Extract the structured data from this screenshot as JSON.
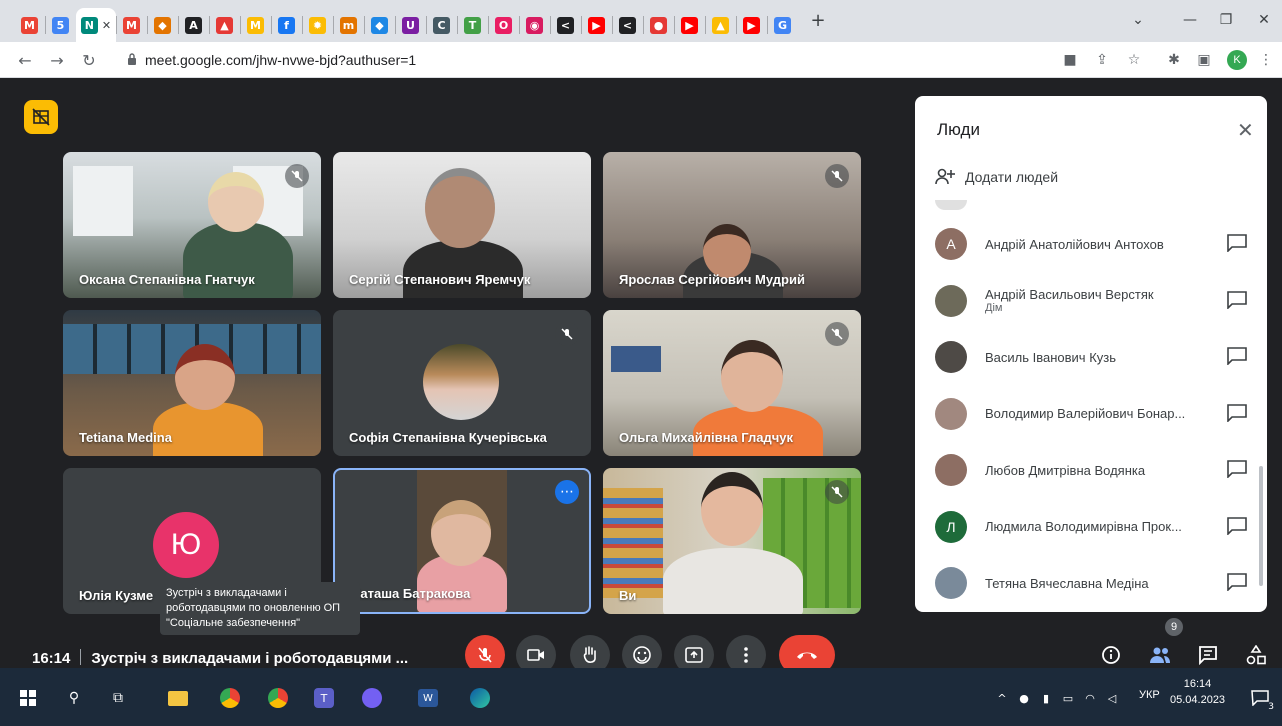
{
  "browser": {
    "url": "meet.google.com/jhw-nvwe-bjd?authuser=1",
    "active_tab_label": "N",
    "new_tab": "+",
    "profile_initial": "K",
    "tab_favicons": [
      {
        "name": "gmail-favicon",
        "glyph": "M",
        "color": "#ea4335"
      },
      {
        "name": "calendar-favicon",
        "glyph": "5",
        "color": "#4285f4"
      },
      {
        "name": "meet-favicon",
        "glyph": "N",
        "color": "#00897b"
      },
      {
        "name": "gmail2-favicon",
        "glyph": "M",
        "color": "#ea4335"
      },
      {
        "name": "app-favicon",
        "glyph": "◆",
        "color": "#e37400"
      },
      {
        "name": "font-favicon",
        "glyph": "A",
        "color": "#202124"
      },
      {
        "name": "pdf-favicon",
        "glyph": "▲",
        "color": "#e53935"
      },
      {
        "name": "m-favicon",
        "glyph": "M",
        "color": "#fbbc04"
      },
      {
        "name": "facebook-favicon",
        "glyph": "f",
        "color": "#1877f2"
      },
      {
        "name": "sun-favicon",
        "glyph": "✹",
        "color": "#fbbc04"
      },
      {
        "name": "m2-favicon",
        "glyph": "m",
        "color": "#e37400"
      },
      {
        "name": "diamond-favicon",
        "glyph": "◆",
        "color": "#1e88e5"
      },
      {
        "name": "u-favicon",
        "glyph": "U",
        "color": "#7b1fa2"
      },
      {
        "name": "c-favicon",
        "glyph": "C",
        "color": "#455a64"
      },
      {
        "name": "testy-favicon",
        "glyph": "T",
        "color": "#43a047"
      },
      {
        "name": "search-favicon",
        "glyph": "O",
        "color": "#e91e63"
      },
      {
        "name": "cake-favicon",
        "glyph": "◉",
        "color": "#d81b60"
      },
      {
        "name": "k-favicon",
        "glyph": "<",
        "color": "#202124"
      },
      {
        "name": "youtube-favicon",
        "glyph": "▶",
        "color": "#ff0000"
      },
      {
        "name": "k2-favicon",
        "glyph": "<",
        "color": "#202124"
      },
      {
        "name": "record-favicon",
        "glyph": "●",
        "color": "#e53935"
      },
      {
        "name": "youtube2-favicon",
        "glyph": "▶",
        "color": "#ff0000"
      },
      {
        "name": "drive-favicon",
        "glyph": "▲",
        "color": "#fbbc04"
      },
      {
        "name": "youtube3-favicon",
        "glyph": "▶",
        "color": "#ff0000"
      },
      {
        "name": "google-favicon",
        "glyph": "G",
        "color": "#4285f4"
      }
    ]
  },
  "tiles": [
    {
      "name": "Оксана Степанівна Гнатчук",
      "muted": true
    },
    {
      "name": "Сергій Степанович Яремчук",
      "muted": false
    },
    {
      "name": "Ярослав Сергійович Мудрий",
      "muted": true
    },
    {
      "name": "Tetiana Medina",
      "muted": false
    },
    {
      "name": "Софія Степанівна Кучерівська",
      "muted": true
    },
    {
      "name": "Ольга Михайлівна Гладчук",
      "muted": true
    },
    {
      "name": "Юлія Кузме",
      "muted": false,
      "initial": "Ю"
    },
    {
      "name": "Наташа Батракова",
      "muted": false
    },
    {
      "name": "Ви",
      "muted": true
    }
  ],
  "tooltip": "Зустріч з викладачами і роботодавцями по оновленню ОП \"Соціальне забезпечення\"",
  "people_panel": {
    "title": "Люди",
    "add_people": "Додати людей",
    "participants": [
      {
        "name": "Андрій Анатолійович Антохов",
        "sub": "",
        "initial": "А",
        "color": "#8d6e63"
      },
      {
        "name": "Андрій Васильович Верстяк",
        "sub": "Дім",
        "initial": "",
        "color": "#6d6a5a"
      },
      {
        "name": "Василь Іванович Кузь",
        "sub": "",
        "initial": "",
        "color": "#4e4a46"
      },
      {
        "name": "Володимир Валерійович Бонар...",
        "sub": "",
        "initial": "",
        "color": "#a1887f"
      },
      {
        "name": "Любов Дмитрівна Водянка",
        "sub": "",
        "initial": "",
        "color": "#8d6e63"
      },
      {
        "name": "Людмила Володимирівна Прок...",
        "sub": "",
        "initial": "Л",
        "color": "#1e6b3a"
      },
      {
        "name": "Тетяна Вячеславна Медіна",
        "sub": "",
        "initial": "",
        "color": "#7a8a9a"
      }
    ]
  },
  "bottom_bar": {
    "time": "16:14",
    "meeting_title": "Зустріч з викладачами і роботодавцями ...",
    "people_count": "9"
  },
  "taskbar": {
    "lang": "УКР",
    "time": "16:14",
    "date": "05.04.2023",
    "notification_count": "3"
  }
}
